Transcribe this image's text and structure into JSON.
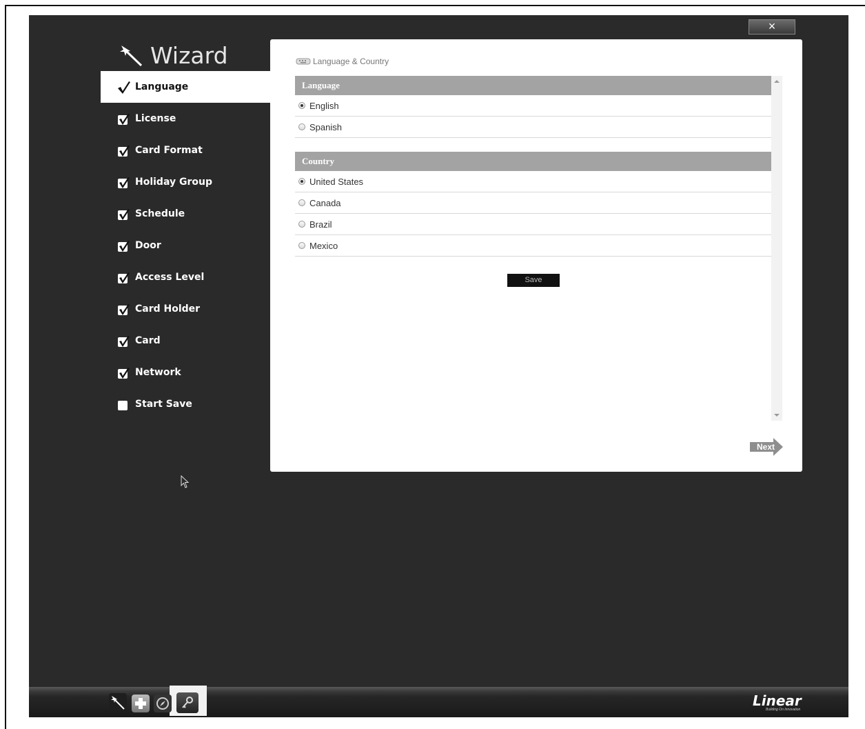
{
  "window": {
    "close_label": "×"
  },
  "wizard": {
    "title": "Wizard"
  },
  "steps": [
    {
      "label": "Language",
      "checked": true,
      "active": true
    },
    {
      "label": "License",
      "checked": true
    },
    {
      "label": "Card Format",
      "checked": true
    },
    {
      "label": "Holiday Group",
      "checked": true
    },
    {
      "label": "Schedule",
      "checked": true
    },
    {
      "label": "Door",
      "checked": true
    },
    {
      "label": "Access Level",
      "checked": true
    },
    {
      "label": "Card Holder",
      "checked": true
    },
    {
      "label": "Card",
      "checked": true
    },
    {
      "label": "Network",
      "checked": true
    },
    {
      "label": "Start Save",
      "checked": false
    }
  ],
  "panel": {
    "breadcrumb": "Language & Country",
    "language": {
      "header": "Language",
      "options": [
        {
          "label": "English",
          "selected": true
        },
        {
          "label": "Spanish",
          "selected": false
        }
      ]
    },
    "country": {
      "header": "Country",
      "options": [
        {
          "label": "United States",
          "selected": true
        },
        {
          "label": "Canada",
          "selected": false
        },
        {
          "label": "Brazil",
          "selected": false
        },
        {
          "label": "Mexico",
          "selected": false
        }
      ]
    },
    "save_label": "Save",
    "next_label": "Next"
  },
  "taskbar": {
    "icons": [
      "wand-icon",
      "plus-icon",
      "compass-icon",
      "key-icon"
    ],
    "logo": "Linear",
    "tagline": "Building On Innovation"
  }
}
